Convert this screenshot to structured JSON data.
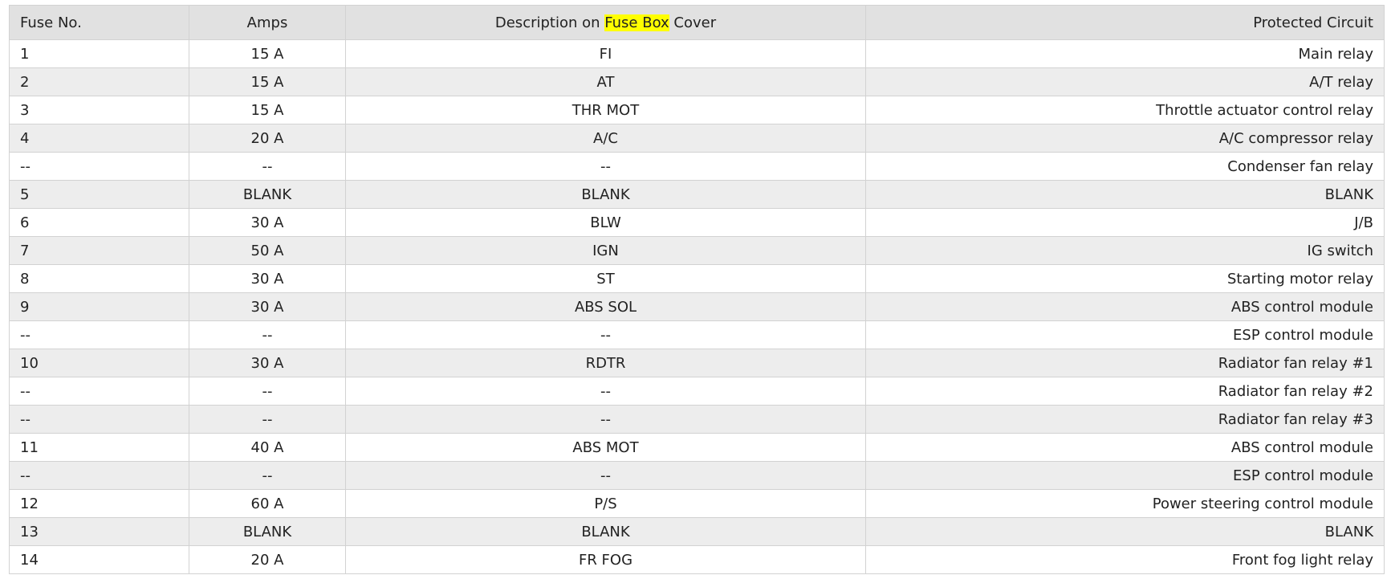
{
  "table": {
    "headers": {
      "fuse_no": "Fuse No.",
      "amps": "Amps",
      "description_prefix": "Description on ",
      "description_highlight": "Fuse Box",
      "description_suffix": " Cover",
      "protected_circuit": "Protected Circuit"
    },
    "highlight_color": "#ffff00",
    "rows": [
      {
        "fuse": "1",
        "amps": "15 A",
        "desc": "FI",
        "circuit": "Main relay"
      },
      {
        "fuse": "2",
        "amps": "15 A",
        "desc": "AT",
        "circuit": "A/T relay"
      },
      {
        "fuse": "3",
        "amps": "15 A",
        "desc": "THR MOT",
        "circuit": "Throttle actuator control relay"
      },
      {
        "fuse": "4",
        "amps": "20 A",
        "desc": "A/C",
        "circuit": "A/C compressor relay"
      },
      {
        "fuse": "--",
        "amps": "--",
        "desc": "--",
        "circuit": "Condenser fan relay"
      },
      {
        "fuse": "5",
        "amps": "BLANK",
        "desc": "BLANK",
        "circuit": "BLANK"
      },
      {
        "fuse": "6",
        "amps": "30 A",
        "desc": "BLW",
        "circuit": "J/B"
      },
      {
        "fuse": "7",
        "amps": "50 A",
        "desc": "IGN",
        "circuit": "IG switch"
      },
      {
        "fuse": "8",
        "amps": "30 A",
        "desc": "ST",
        "circuit": "Starting motor relay"
      },
      {
        "fuse": "9",
        "amps": "30 A",
        "desc": "ABS SOL",
        "circuit": "ABS control module"
      },
      {
        "fuse": "--",
        "amps": "--",
        "desc": "--",
        "circuit": "ESP control module"
      },
      {
        "fuse": "10",
        "amps": "30 A",
        "desc": "RDTR",
        "circuit": "Radiator fan relay #1"
      },
      {
        "fuse": "--",
        "amps": "--",
        "desc": "--",
        "circuit": "Radiator fan relay #2"
      },
      {
        "fuse": "--",
        "amps": "--",
        "desc": "--",
        "circuit": "Radiator fan relay #3"
      },
      {
        "fuse": "11",
        "amps": "40 A",
        "desc": "ABS MOT",
        "circuit": "ABS control module"
      },
      {
        "fuse": "--",
        "amps": "--",
        "desc": "--",
        "circuit": "ESP control module"
      },
      {
        "fuse": "12",
        "amps": "60 A",
        "desc": "P/S",
        "circuit": "Power steering control module"
      },
      {
        "fuse": "13",
        "amps": "BLANK",
        "desc": "BLANK",
        "circuit": "BLANK"
      },
      {
        "fuse": "14",
        "amps": "20 A",
        "desc": "FR FOG",
        "circuit": "Front fog light relay"
      }
    ]
  }
}
